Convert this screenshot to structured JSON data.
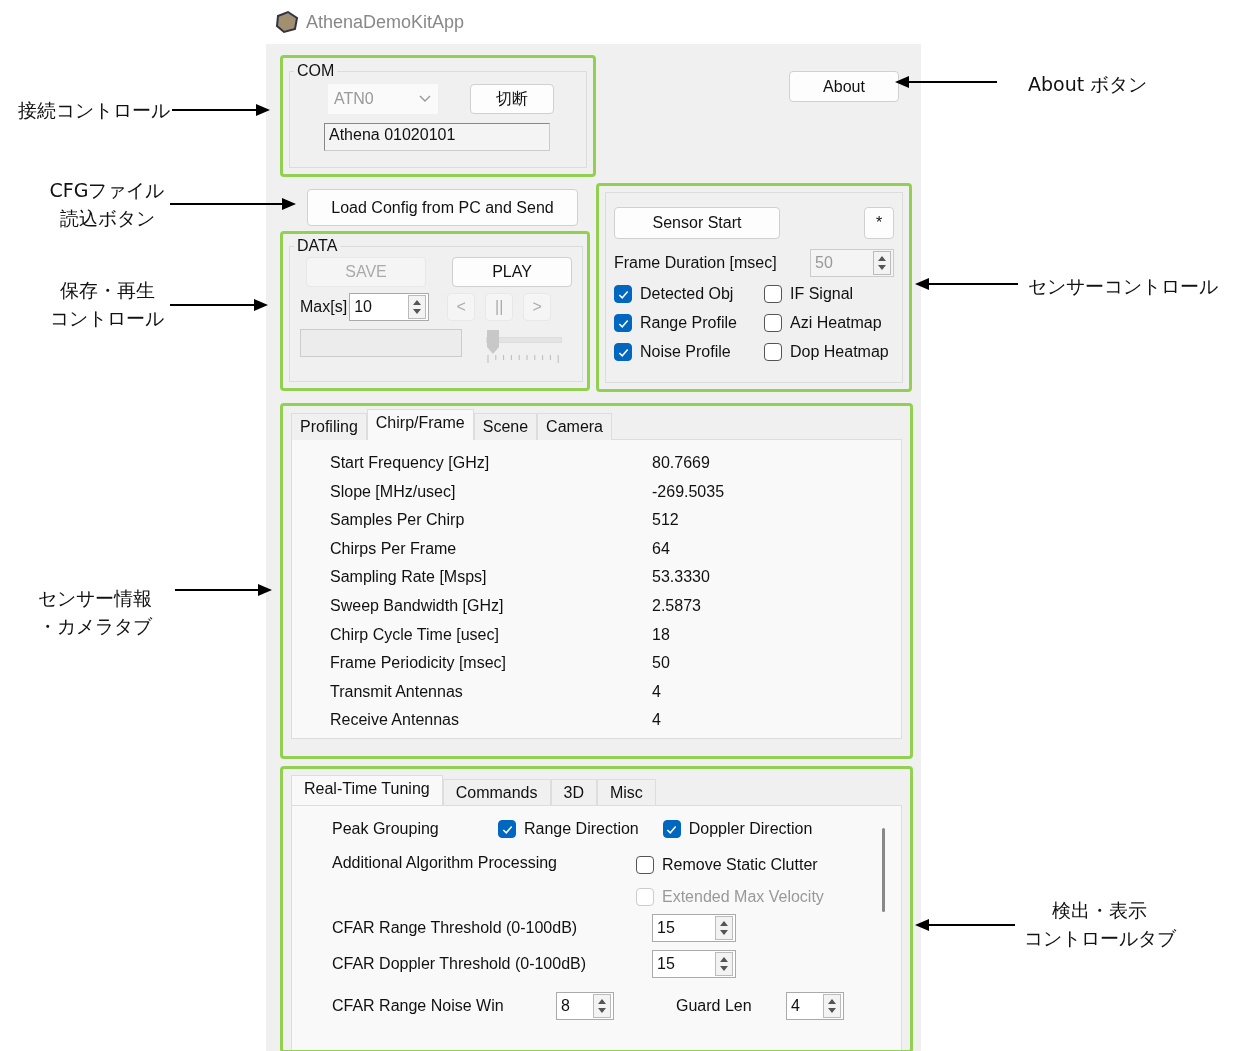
{
  "window": {
    "title": "AthenaDemoKitApp"
  },
  "com_group": {
    "title": "COM",
    "port": {
      "value": "ATN0",
      "disabled": true
    },
    "disconnect_button": "切断",
    "device": "Athena 01020101"
  },
  "about_button": "About",
  "load_config_button": "Load Config from PC and Send",
  "data_group": {
    "title": "DATA",
    "buttons": [
      {
        "label": "SAVE",
        "disabled": true
      },
      {
        "label": "PLAY",
        "disabled": false
      }
    ],
    "max_label": "Max[s]",
    "max_value": "10",
    "nav_buttons": [
      {
        "label": "<",
        "disabled": true
      },
      {
        "label": "||",
        "disabled": true
      },
      {
        "label": ">",
        "disabled": true
      }
    ],
    "slider": {
      "level": 0,
      "disabled": true
    }
  },
  "sensor_group": {
    "start_button": "Sensor Start",
    "star_button": "*",
    "frame_duration": {
      "label": "Frame Duration [msec]",
      "value": "50",
      "disabled": true
    },
    "checkboxes": [
      {
        "label": "Detected Obj",
        "checked": true
      },
      {
        "label": "IF Signal",
        "checked": false
      },
      {
        "label": "Range Profile",
        "checked": true
      },
      {
        "label": "Azi Heatmap",
        "checked": false
      },
      {
        "label": "Noise Profile",
        "checked": true
      },
      {
        "label": "Dop Heatmap",
        "checked": false
      }
    ]
  },
  "info_tabs": {
    "tabs": [
      {
        "label": "Profiling",
        "selected": false
      },
      {
        "label": "Chirp/Frame",
        "selected": true
      },
      {
        "label": "Scene",
        "selected": false
      },
      {
        "label": "Camera",
        "selected": false
      }
    ],
    "rows": [
      {
        "label": "Start Frequency [GHz]",
        "value": "80.7669"
      },
      {
        "label": "Slope [MHz/usec]",
        "value": "-269.5035"
      },
      {
        "label": "Samples Per Chirp",
        "value": "512"
      },
      {
        "label": "Chirps Per Frame",
        "value": "64"
      },
      {
        "label": "Sampling Rate [Msps]",
        "value": "53.3330"
      },
      {
        "label": "Sweep Bandwidth [GHz]",
        "value": "2.5873"
      },
      {
        "label": "Chirp Cycle Time [usec]",
        "value": "18"
      },
      {
        "label": "Frame Periodicity [msec]",
        "value": "50"
      },
      {
        "label": "Transmit Antennas",
        "value": "4"
      },
      {
        "label": "Receive Antennas",
        "value": "4"
      }
    ]
  },
  "tuning_tabs": {
    "tabs": [
      {
        "label": "Real-Time Tuning",
        "selected": true
      },
      {
        "label": "Commands",
        "selected": false
      },
      {
        "label": "3D",
        "selected": false
      },
      {
        "label": "Misc",
        "selected": false
      }
    ],
    "peak_grouping": {
      "label": "Peak Grouping",
      "options": [
        {
          "label": "Range Direction",
          "checked": true,
          "disabled": false
        },
        {
          "label": "Doppler Direction",
          "checked": true,
          "disabled": false
        }
      ]
    },
    "algorithm": {
      "label": "Additional Algorithm Processing",
      "options": [
        {
          "label": "Remove Static Clutter",
          "checked": false,
          "disabled": false
        },
        {
          "label": "Extended Max Velocity",
          "checked": false,
          "disabled": true
        }
      ]
    },
    "thresholds": [
      {
        "label": "CFAR Range Threshold (0-100dB)",
        "value": "15"
      },
      {
        "label": "CFAR Doppler Threshold (0-100dB)",
        "value": "15"
      }
    ],
    "noise_row": [
      {
        "label": "CFAR Range Noise Win",
        "value": "8"
      },
      {
        "label": "Guard Len",
        "value": "4"
      }
    ]
  },
  "annotations": {
    "left": [
      {
        "lines": [
          "接続コントロール"
        ]
      },
      {
        "lines": [
          "CFGファイル",
          "読込ボタン"
        ]
      },
      {
        "lines": [
          "保存・再生",
          "コントロール"
        ]
      },
      {
        "lines": [
          "センサー情報",
          "・カメラタブ"
        ]
      }
    ],
    "right": [
      {
        "lines": [
          "About ボタン"
        ]
      },
      {
        "lines": [
          "センサーコントロール"
        ]
      },
      {
        "lines": [
          "検出・表示",
          "コントロールタブ"
        ]
      }
    ]
  }
}
